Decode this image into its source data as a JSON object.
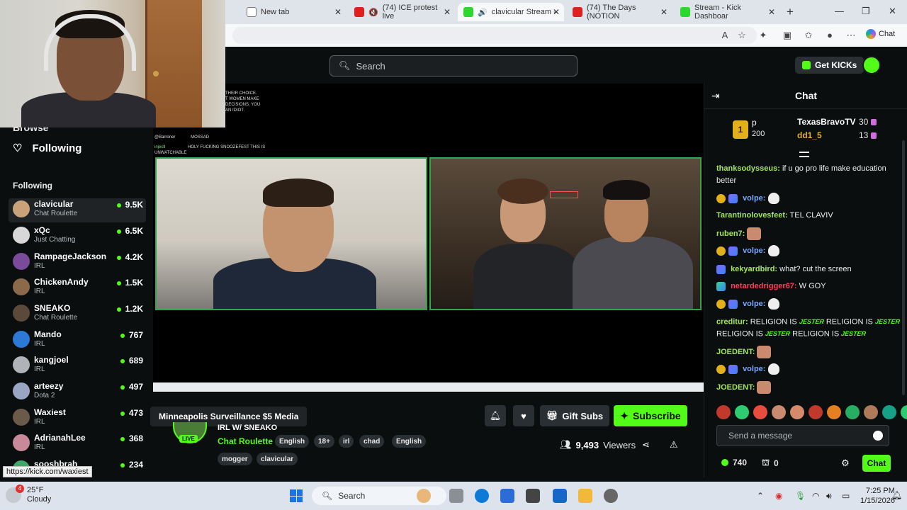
{
  "browser": {
    "tabs": [
      {
        "title": "New tab",
        "icon": "blank-tab-icon"
      },
      {
        "title": "(74) ICE protest live",
        "icon": "youtube-icon"
      },
      {
        "title": "clavicular Stream -",
        "icon": "kick-icon"
      },
      {
        "title": "(74) The Days (NOTION",
        "icon": "youtube-icon"
      },
      {
        "title": "Stream - Kick Dashboar",
        "icon": "kick-icon"
      }
    ],
    "copilot_label": "Chat"
  },
  "header": {
    "search_placeholder": "Search",
    "get_kicks_label": "Get KICKs"
  },
  "sidebar": {
    "browse_label": "Browse",
    "following_nav_label": "Following",
    "following_heading": "Following",
    "channels": [
      {
        "name": "clavicular",
        "category": "Chat Roulette",
        "viewers": "9.5K",
        "color": "#c9a27a"
      },
      {
        "name": "xQc",
        "category": "Just Chatting",
        "viewers": "6.5K",
        "color": "#d8d8d8"
      },
      {
        "name": "RampageJackson",
        "category": "IRL",
        "viewers": "4.2K",
        "color": "#7a4b9b"
      },
      {
        "name": "ChickenAndy",
        "category": "IRL",
        "viewers": "1.5K",
        "color": "#8b6a4a"
      },
      {
        "name": "SNEAKO",
        "category": "Chat Roulette",
        "viewers": "1.2K",
        "color": "#5b4a3a"
      },
      {
        "name": "Mando",
        "category": "IRL",
        "viewers": "767",
        "color": "#2d7ad6"
      },
      {
        "name": "kangjoel",
        "category": "IRL",
        "viewers": "689",
        "color": "#b0b4b8"
      },
      {
        "name": "arteezy",
        "category": "Dota 2",
        "viewers": "497",
        "color": "#9aa6c4"
      },
      {
        "name": "Waxiest",
        "category": "IRL",
        "viewers": "473",
        "color": "#6b5a4a"
      },
      {
        "name": "AdrianahLee",
        "category": "IRL",
        "viewers": "368",
        "color": "#c88a9a"
      },
      {
        "name": "sooshbrah",
        "category": "",
        "viewers": "234",
        "color": "#3ea86a"
      }
    ],
    "status_url": "https://kick.com/waxiest"
  },
  "stream": {
    "tooltip": "Minneapolis Surveillance $5 Media",
    "title": "IRL W/ SNEAKO",
    "live_label": "LIVE",
    "category": "Chat Roulette",
    "tags": [
      "English",
      "18+",
      "irl",
      "chad",
      "English",
      "mogger",
      "clavicular"
    ],
    "gift_subs_label": "Gift Subs",
    "subscribe_label": "Subscribe",
    "viewer_count": "9,493",
    "viewers_label": "Viewers",
    "overlay_chat": [
      {
        "user": "",
        "text": "THEIR CHOICE."
      },
      {
        "user": "",
        "text": "T WOMEN MAKE"
      },
      {
        "user": "",
        "text": "DECISIONS. YOU"
      },
      {
        "user": "",
        "text": "AN IDIOT."
      },
      {
        "user": "@Barroner",
        "text": "MOSSAD"
      },
      {
        "user": "injectl",
        "text": "HOLY FUCKING SNOOZEFEST THIS IS UNWATCHABLE"
      }
    ]
  },
  "chat": {
    "title": "Chat",
    "leaderboard": {
      "rank": "1",
      "top_user": "p",
      "top_amount": "200",
      "entries": [
        {
          "user": "TexasBravoTV",
          "amount": "30"
        },
        {
          "user": "dd1_5",
          "amount": "13"
        }
      ]
    },
    "messages": [
      {
        "user": "thanksodysseus:",
        "text": "if u go pro life make education better",
        "color": "#a3e65a"
      },
      {
        "user": "volpe:",
        "text": "",
        "color": "#7aa7ff"
      },
      {
        "user": "Tarantinolovesfeet:",
        "text": "TEL CLAVIV",
        "color": "#a3e65a"
      },
      {
        "user": "ruben7:",
        "text": "",
        "color": "#a3e65a"
      },
      {
        "user": "volpe:",
        "text": "",
        "color": "#7aa7ff"
      },
      {
        "user": "kekyardbird:",
        "text": "what? cut the screen",
        "color": "#a3e65a"
      },
      {
        "user": "netardedrigger67:",
        "text": "W GOY",
        "color": "#ff3d5a"
      },
      {
        "user": "volpe:",
        "text": "",
        "color": "#7aa7ff"
      },
      {
        "user": "creditur:",
        "text": "RELIGION IS",
        "color": "#a3e65a"
      },
      {
        "user": "JOEDENT:",
        "text": "",
        "color": "#a3e65a"
      },
      {
        "user": "volpe:",
        "text": "",
        "color": "#7aa7ff"
      },
      {
        "user": "JOEDENT:",
        "text": "",
        "color": "#a3e65a"
      }
    ],
    "jester_text": "JESTER",
    "religion_text": "RELIGION IS",
    "input_placeholder": "Send a message",
    "points": "740",
    "gifts": "0",
    "send_label": "Chat"
  },
  "taskbar": {
    "weather_temp": "25°F",
    "weather_desc": "Cloudy",
    "weather_badge": "4",
    "search_label": "Search",
    "time": "7:25 PM",
    "date": "1/15/2026"
  }
}
